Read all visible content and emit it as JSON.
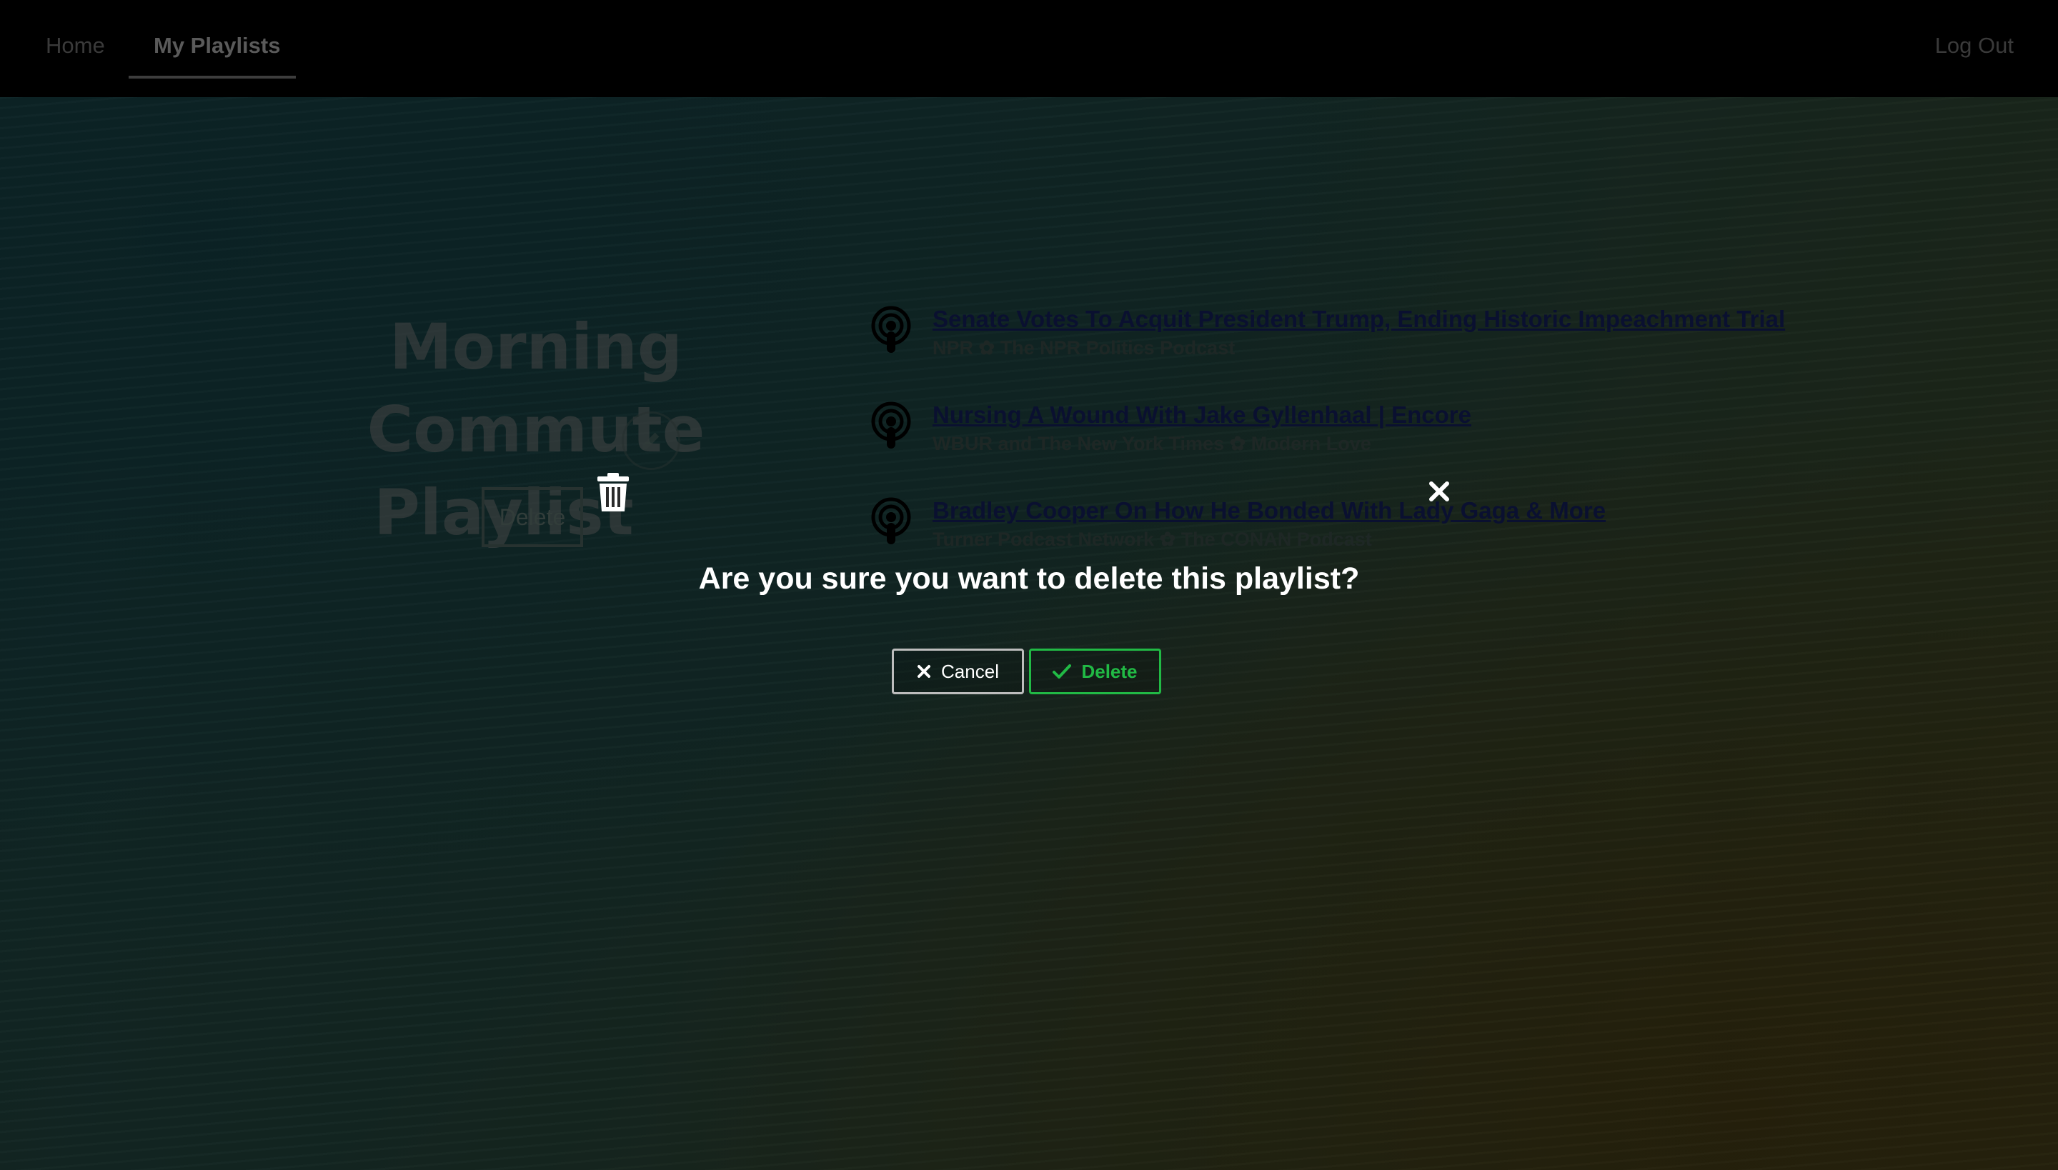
{
  "nav": {
    "home": "Home",
    "my_playlists": "My Playlists",
    "log_out": "Log Out"
  },
  "playlist": {
    "title_line1": "Morning Commute",
    "title_line2": "Playlist",
    "delete_label": "Delete"
  },
  "episodes": [
    {
      "title": "Senate Votes To Acquit President Trump, Ending Historic Impeachment Trial",
      "meta": "NPR ✿ The NPR Politics Podcast"
    },
    {
      "title": "Nursing A Wound With Jake Gyllenhaal | Encore",
      "meta": "WBUR and The New York Times ✿ Modern Love"
    },
    {
      "title": "Bradley Cooper On How He Bonded With Lady Gaga & More",
      "meta": "Turner Podcast Network ✿ The CONAN Podcast"
    }
  ],
  "modal": {
    "question": "Are you sure you want to delete this playlist?",
    "cancel_label": "Cancel",
    "delete_label": "Delete",
    "icon": "trash-icon",
    "close_icon": "close-icon"
  },
  "colors": {
    "confirm": "#21ba45",
    "navbar": "#000000"
  }
}
